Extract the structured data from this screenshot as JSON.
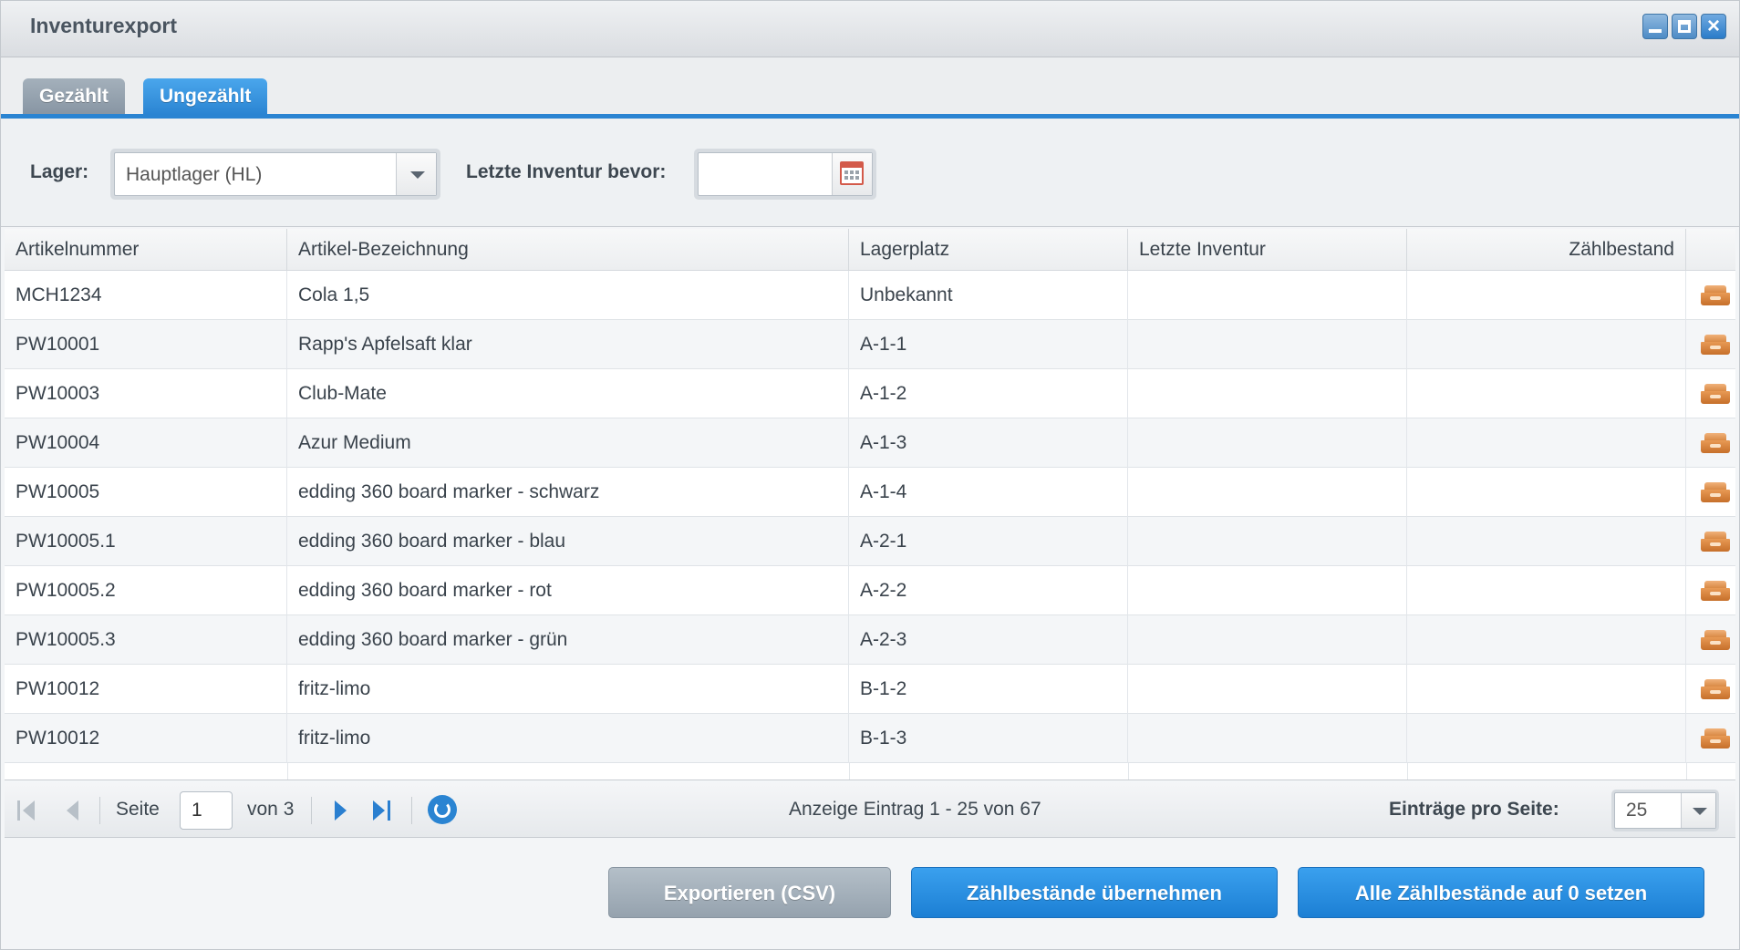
{
  "window": {
    "title": "Inventurexport"
  },
  "tabs": [
    {
      "label": "Gezählt",
      "active": false
    },
    {
      "label": "Ungezählt",
      "active": true
    }
  ],
  "filters": {
    "lager_label": "Lager:",
    "lager_value": "Hauptlager (HL)",
    "inventur_label": "Letzte Inventur bevor:",
    "inventur_value": ""
  },
  "grid": {
    "columns": [
      "Artikelnummer",
      "Artikel-Bezeichnung",
      "Lagerplatz",
      "Letzte Inventur",
      "Zählbestand"
    ],
    "rows": [
      {
        "nr": "MCH1234",
        "name": "Cola 1,5",
        "platz": "Unbekannt",
        "inventur": "",
        "bestand": ""
      },
      {
        "nr": "PW10001",
        "name": "Rapp's Apfelsaft klar",
        "platz": "A-1-1",
        "inventur": "",
        "bestand": ""
      },
      {
        "nr": "PW10003",
        "name": "Club-Mate",
        "platz": "A-1-2",
        "inventur": "",
        "bestand": ""
      },
      {
        "nr": "PW10004",
        "name": "Azur Medium",
        "platz": "A-1-3",
        "inventur": "",
        "bestand": ""
      },
      {
        "nr": "PW10005",
        "name": "edding 360 board marker - schwarz",
        "platz": "A-1-4",
        "inventur": "",
        "bestand": ""
      },
      {
        "nr": "PW10005.1",
        "name": "edding 360 board marker - blau",
        "platz": "A-2-1",
        "inventur": "",
        "bestand": ""
      },
      {
        "nr": "PW10005.2",
        "name": "edding 360 board marker - rot",
        "platz": "A-2-2",
        "inventur": "",
        "bestand": ""
      },
      {
        "nr": "PW10005.3",
        "name": "edding 360 board marker - grün",
        "platz": "A-2-3",
        "inventur": "",
        "bestand": ""
      },
      {
        "nr": "PW10012",
        "name": "fritz-limo",
        "platz": "B-1-2",
        "inventur": "",
        "bestand": ""
      },
      {
        "nr": "PW10012",
        "name": "fritz-limo",
        "platz": "B-1-3",
        "inventur": "",
        "bestand": ""
      }
    ]
  },
  "pager": {
    "seite_label": "Seite",
    "page": "1",
    "of_label": "von 3",
    "display_text": "Anzeige Eintrag 1 - 25 von 67",
    "per_page_label": "Einträge pro Seite:",
    "per_page_value": "25"
  },
  "buttons": {
    "export": "Exportieren (CSV)",
    "apply": "Zählbestände übernehmen",
    "reset": "Alle Zählbestände auf 0 setzen"
  },
  "colors": {
    "accent": "#2a84d2",
    "box_icon": "#d98a45"
  }
}
